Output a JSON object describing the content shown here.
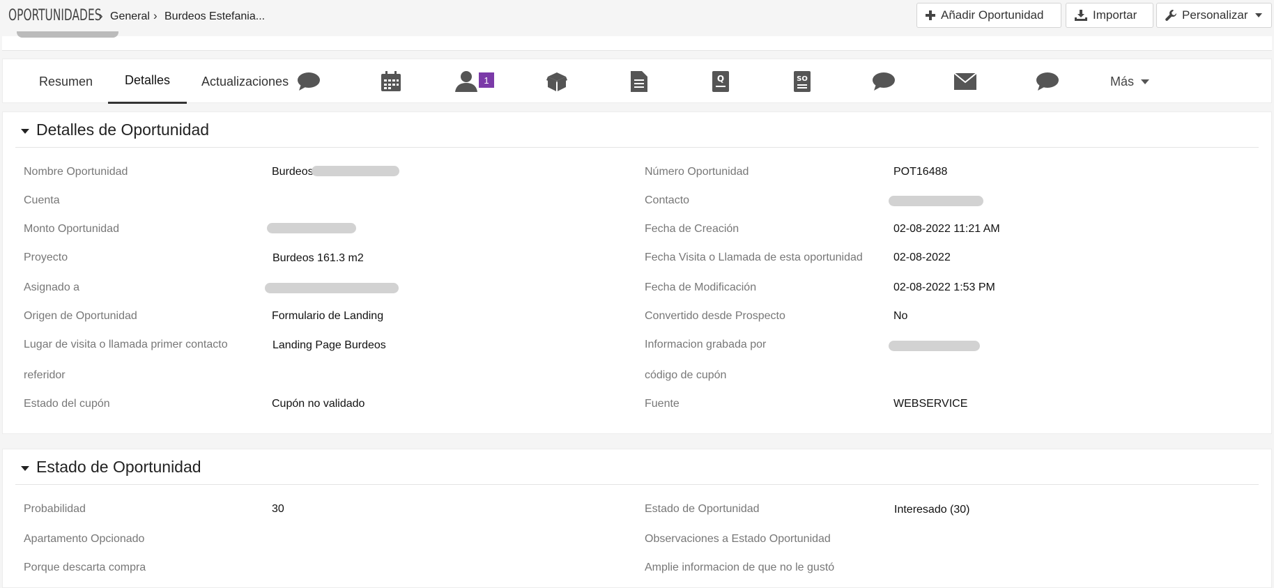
{
  "header": {
    "module": "OPORTUNIDADES",
    "breadcrumb": [
      "General",
      "Burdeos Estefania..."
    ],
    "buttons": {
      "add": "Añadir Oportunidad",
      "import": "Importar",
      "customize": "Personalizar"
    }
  },
  "tabs": {
    "summary": "Resumen",
    "details": "Detalles",
    "updates": "Actualizaciones",
    "contacts_badge": "1",
    "more": "Más"
  },
  "details": {
    "title": "Detalles de Oportunidad",
    "left": [
      {
        "label": "Nombre Oportunidad",
        "value": "Burdeos"
      },
      {
        "label": "Cuenta",
        "value": ""
      },
      {
        "label": "Monto Oportunidad",
        "value": ""
      },
      {
        "label": "Proyecto",
        "value": "Burdeos 161.3 m2"
      },
      {
        "label": "Asignado a",
        "value": ""
      },
      {
        "label": "Origen de Oportunidad",
        "value": "Formulario de Landing"
      },
      {
        "label": "Lugar de visita o llamada primer contacto",
        "value": "Landing Page Burdeos"
      },
      {
        "label": "referidor",
        "value": ""
      },
      {
        "label": "Estado del cupón",
        "value": "Cupón no validado"
      }
    ],
    "right": [
      {
        "label": "Número Oportunidad",
        "value": "POT16488"
      },
      {
        "label": "Contacto",
        "value": ""
      },
      {
        "label": "Fecha de Creación",
        "value": "02-08-2022 11:21 AM"
      },
      {
        "label": "Fecha Visita o Llamada de esta oportunidad",
        "value": "02-08-2022"
      },
      {
        "label": "Fecha de Modificación",
        "value": "02-08-2022 1:53 PM"
      },
      {
        "label": "Convertido desde Prospecto",
        "value": "No"
      },
      {
        "label": "Informacion grabada por",
        "value": ""
      },
      {
        "label": "código de cupón",
        "value": ""
      },
      {
        "label": "Fuente",
        "value": "WEBSERVICE"
      }
    ]
  },
  "status": {
    "title": "Estado de Oportunidad",
    "left": [
      {
        "label": "Probabilidad",
        "value": "30"
      },
      {
        "label": "Apartamento Opcionado",
        "value": ""
      },
      {
        "label": "Porque descarta compra",
        "value": ""
      }
    ],
    "right": [
      {
        "label": "Estado de Oportunidad",
        "value": "Interesado (30)"
      },
      {
        "label": "Observaciones a Estado Oportunidad",
        "value": ""
      },
      {
        "label": "Amplie informacion de que no le gustó",
        "value": ""
      }
    ]
  },
  "colors": {
    "accent_badge": "#7b3aa8",
    "icon_gray": "#555555"
  }
}
